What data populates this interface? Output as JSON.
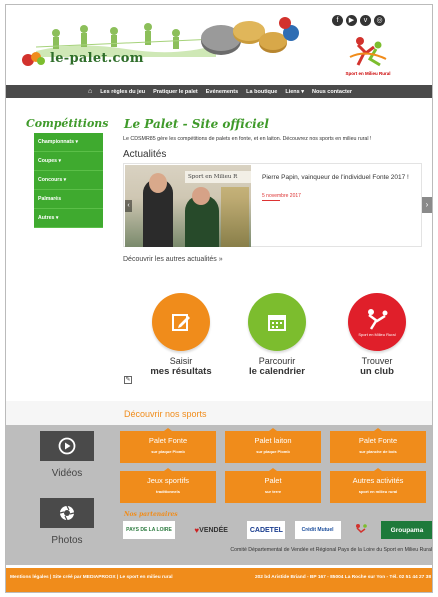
{
  "header": {
    "logo_text": "le-palet.com",
    "social_icons": [
      "facebook-icon",
      "youtube-icon",
      "vimeo-icon",
      "instagram-icon"
    ],
    "sport_logo_text": "Sport en Milieu Rural"
  },
  "nav": {
    "items": [
      "Les règles du jeu",
      "Pratiquer le palet",
      "Evénements",
      "La boutique",
      "Liens ▾",
      "Nous contacter"
    ]
  },
  "sidebar": {
    "title": "Compétitions",
    "items": [
      "Championnats ▾",
      "Coupes ▾",
      "Concours ▾",
      "Palmarès",
      "Autres ▾"
    ]
  },
  "main": {
    "title": "Le Palet - Site officiel",
    "intro": "Le CDSMR85 gère les compétitions de palets en fonte, et en laiton. Découvrez nos sports en milieu rural !",
    "news_heading": "Actualités",
    "news": {
      "photo_banner": "Sport en Milieu R",
      "caption": "Pierre Papin, vainqueur de l'individuel Fonte 2017 !",
      "date": "5 novembre 2017"
    },
    "more_news": "Découvrir les autres actualités »"
  },
  "actions": [
    {
      "line1": "Saisir",
      "line2": "mes résultats",
      "color": "#f08c1b",
      "icon": "edit-icon"
    },
    {
      "line1": "Parcourir",
      "line2": "le calendrier",
      "color": "#7cbd2e",
      "icon": "calendar-icon"
    },
    {
      "line1": "Trouver",
      "line2": "un club",
      "color": "#e01f2a",
      "icon": "club-logo-icon",
      "logo_text": "Sport en Milieu Rural"
    }
  ],
  "sports": {
    "title": "Découvrir nos sports",
    "media": [
      {
        "label": "Vidéos",
        "icon": "play-icon"
      },
      {
        "label": "Photos",
        "icon": "camera-icon"
      }
    ],
    "buttons": [
      {
        "title": "Palet Fonte",
        "sub": "sur plaque Plomb"
      },
      {
        "title": "Palet laiton",
        "sub": "sur plaque Plomb"
      },
      {
        "title": "Palet Fonte",
        "sub": "sur planche de bois"
      },
      {
        "title": "Jeux sportifs",
        "sub": "traditionnels"
      },
      {
        "title": "Palet",
        "sub": "sur terre"
      },
      {
        "title": "Autres activités",
        "sub": "sport en milieu rural"
      }
    ],
    "partners_title": "Nos partenaires",
    "partners": [
      "PAYS DE LA LOIRE",
      "VENDÉE",
      "CADETEL",
      "Crédit Mutuel",
      "",
      "Groupama"
    ],
    "comite": "Comité Départemental de Vendée et Régional Pays de la Loire du Sport en Milieu Rural"
  },
  "footer": {
    "left": "Mentions légales | Site créé par MEDIAPROOX | Le sport en milieu rural",
    "right": "202 bd Aristide Briand - BP 167 - 85004 La Roche sur Yon - Tél. 02 51 44 27 38"
  },
  "colors": {
    "green": "#3faa2f",
    "orange": "#f08c1b",
    "red": "#e01f2a",
    "nav": "#4a4a4a"
  }
}
